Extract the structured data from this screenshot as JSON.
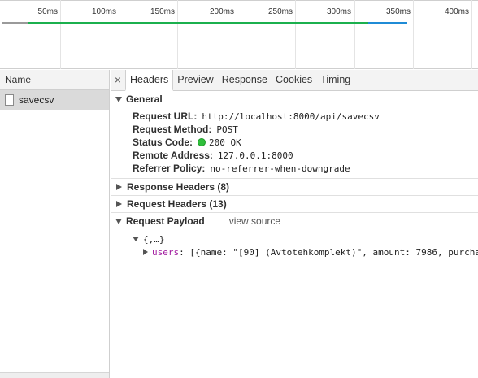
{
  "timeline": {
    "ticks": [
      "50ms",
      "100ms",
      "150ms",
      "200ms",
      "250ms",
      "300ms",
      "350ms",
      "400ms"
    ],
    "colors": {
      "waiting": "#1bb04e",
      "download": "#1f8bd6"
    }
  },
  "request_list": {
    "column_header": "Name",
    "rows": [
      {
        "name": "savecsv",
        "icon": "document-icon",
        "selected": true
      }
    ]
  },
  "detail": {
    "close_icon": "close-icon",
    "tabs": [
      {
        "label": "Headers",
        "active": true
      },
      {
        "label": "Preview",
        "active": false
      },
      {
        "label": "Response",
        "active": false
      },
      {
        "label": "Cookies",
        "active": false
      },
      {
        "label": "Timing",
        "active": false
      }
    ],
    "general": {
      "title": "General",
      "expanded": true,
      "fields": [
        {
          "key": "Request URL:",
          "value": "http://localhost:8000/api/savecsv"
        },
        {
          "key": "Request Method:",
          "value": "POST"
        },
        {
          "key": "Status Code:",
          "value": "200 OK",
          "status_color": "#2fbf3b"
        },
        {
          "key": "Remote Address:",
          "value": "127.0.0.1:8000"
        },
        {
          "key": "Referrer Policy:",
          "value": "no-referrer-when-downgrade"
        }
      ]
    },
    "response_headers": {
      "title": "Response Headers (8)",
      "expanded": false
    },
    "request_headers": {
      "title": "Request Headers (13)",
      "expanded": false
    },
    "request_payload": {
      "title": "Request Payload",
      "view_source": "view source",
      "expanded": true,
      "root": "{,…}",
      "property_key": "users",
      "property_value": ": [{name: \"[90] (Avtotehkomplekt)\", amount: 7986, purcha"
    }
  }
}
